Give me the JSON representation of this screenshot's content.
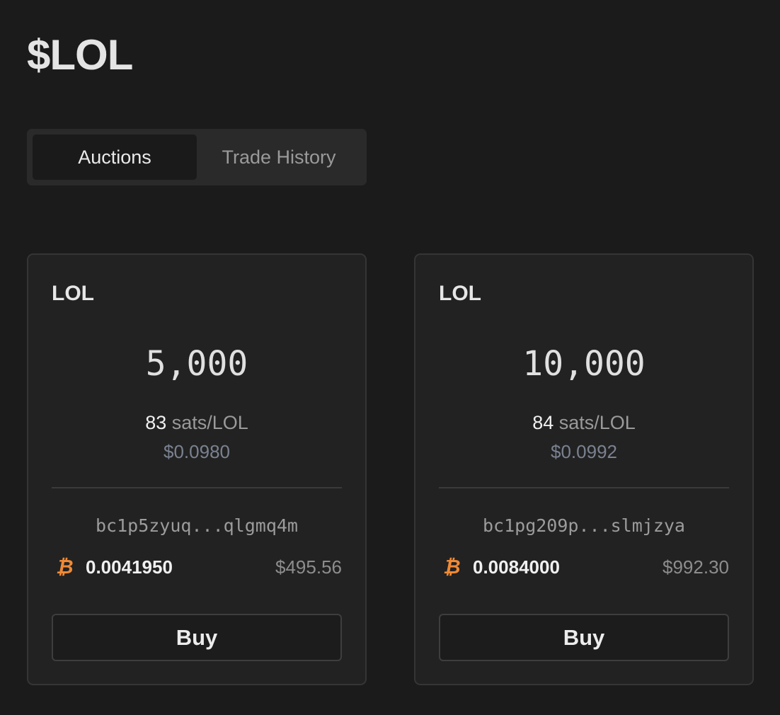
{
  "page": {
    "title": "$LOL"
  },
  "tabs": [
    {
      "label": "Auctions",
      "active": true
    },
    {
      "label": "Trade History",
      "active": false
    }
  ],
  "listings": [
    {
      "token": "LOL",
      "amount": "5,000",
      "rate_value": "83",
      "rate_unit": "sats/LOL",
      "unit_usd": "$0.0980",
      "seller_address": "bc1p5zyuq...qlgmq4m",
      "btc_icon": "bitcoin-icon",
      "btc_amount": "0.0041950",
      "usd_total": "$495.56",
      "button_label": "Buy"
    },
    {
      "token": "LOL",
      "amount": "10,000",
      "rate_value": "84",
      "rate_unit": "sats/LOL",
      "unit_usd": "$0.0992",
      "seller_address": "bc1pg209p...slmjzya",
      "btc_icon": "bitcoin-icon",
      "btc_amount": "0.0084000",
      "usd_total": "$992.30",
      "button_label": "Buy"
    }
  ],
  "colors": {
    "background": "#1b1b1b",
    "card": "#222222",
    "bitcoin_accent": "#f08a35",
    "usd_muted": "#7a8290"
  }
}
